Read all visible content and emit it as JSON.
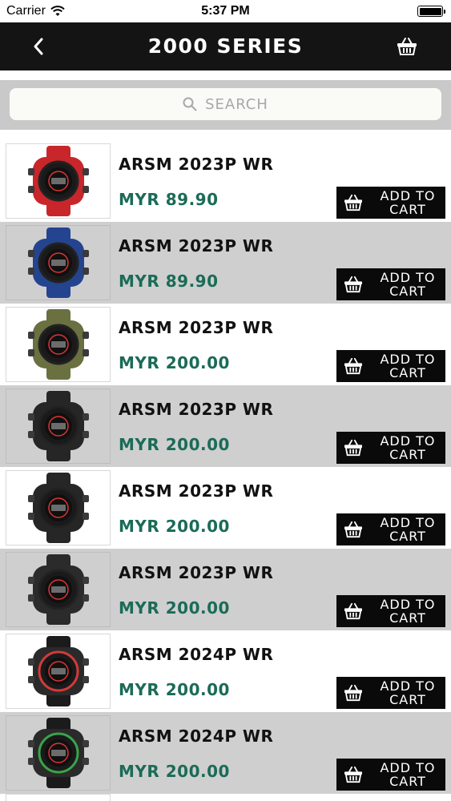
{
  "status_bar": {
    "carrier": "Carrier",
    "time": "5:37 PM"
  },
  "header": {
    "title": "2000 SERIES",
    "back_icon": "chevron-left-icon",
    "cart_icon": "basket-icon"
  },
  "search": {
    "placeholder": "SEARCH"
  },
  "colors": {
    "nav_bg": "#141414",
    "price": "#1b6b57",
    "alt_row": "#cfcfcf",
    "button_bg": "#0a0a0a"
  },
  "products": [
    {
      "name": "ARSM 2023P WR",
      "price": "MYR 89.90",
      "button": "ADD TO\nCART",
      "watch_color": "#c8262b",
      "style": "a"
    },
    {
      "name": "ARSM 2023P WR",
      "price": "MYR 89.90",
      "button": "ADD TO\nCART",
      "watch_color": "#25448f",
      "style": "a"
    },
    {
      "name": "ARSM 2023P WR",
      "price": "MYR 200.00",
      "button": "ADD TO\nCART",
      "watch_color": "#6a7040",
      "style": "a"
    },
    {
      "name": "ARSM 2023P WR",
      "price": "MYR 200.00",
      "button": "ADD TO\nCART",
      "watch_color": "#262626",
      "style": "a"
    },
    {
      "name": "ARSM 2023P WR",
      "price": "MYR 200.00",
      "button": "ADD TO\nCART",
      "watch_color": "#262626",
      "style": "a"
    },
    {
      "name": "ARSM 2023P WR",
      "price": "MYR 200.00",
      "button": "ADD TO\nCART",
      "watch_color": "#2b2b2b",
      "style": "a"
    },
    {
      "name": "ARSM 2024P WR",
      "price": "MYR 200.00",
      "button": "ADD TO\nCART",
      "watch_color": "#d33a3a",
      "style": "b"
    },
    {
      "name": "ARSM 2024P WR",
      "price": "MYR 200.00",
      "button": "ADD TO\nCART",
      "watch_color": "#3aa34a",
      "style": "b"
    }
  ]
}
